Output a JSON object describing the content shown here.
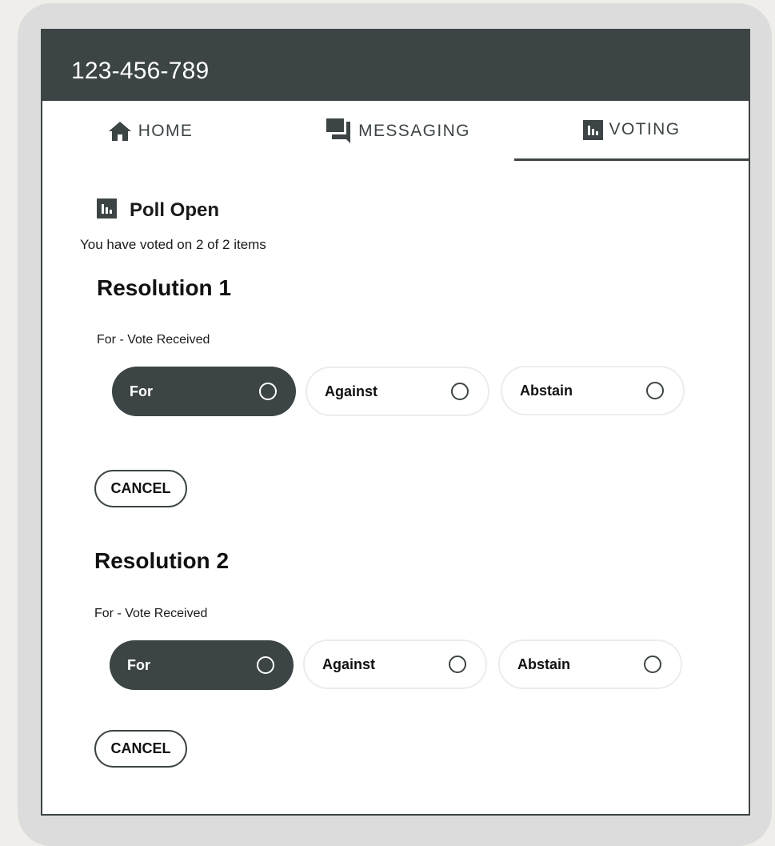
{
  "appbar": {
    "title": "123-456-789"
  },
  "tabs": [
    {
      "label": "HOME",
      "icon": "home-icon"
    },
    {
      "label": "MESSAGING",
      "icon": "chat-icon"
    },
    {
      "label": "VOTING",
      "icon": "poll-icon",
      "active": true
    }
  ],
  "poll": {
    "title": "Poll Open",
    "icon": "poll-icon",
    "status": "You have voted on 2 of 2 items"
  },
  "resolutions": [
    {
      "title": "Resolution 1",
      "status": "For - Vote Received",
      "options": [
        "For",
        "Against",
        "Abstain"
      ],
      "selected": "For",
      "cancel_label": "CANCEL"
    },
    {
      "title": "Resolution 2",
      "status": "For - Vote Received",
      "options": [
        "For",
        "Against",
        "Abstain"
      ],
      "selected": "For",
      "cancel_label": "CANCEL"
    }
  ],
  "colors": {
    "primary": "#3d4446",
    "background": "#ffffff",
    "frame": "#dcdcdc"
  }
}
